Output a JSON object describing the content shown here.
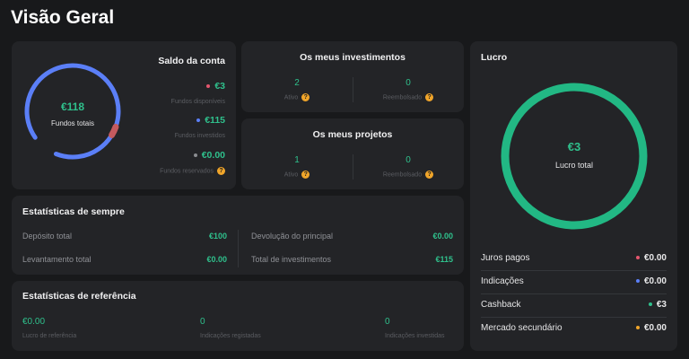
{
  "page": {
    "title": "Visão Geral"
  },
  "account": {
    "title": "Saldo da conta",
    "center_value": "€118",
    "center_label": "Fundos totais",
    "items": [
      {
        "value": "€3",
        "label": "Fundos disponíveis",
        "color": "#e4566e"
      },
      {
        "value": "€115",
        "label": "Fundos investidos",
        "color": "#5b7ff7"
      },
      {
        "value": "€0.00",
        "label": "Fundos reservados",
        "color": "#8a8c90"
      }
    ],
    "ring_colors": {
      "invested": "#5b7ff7",
      "available": "#c45a5e"
    }
  },
  "investments": {
    "title": "Os meus investimentos",
    "active_value": "2",
    "active_label": "Ativo",
    "repaid_value": "0",
    "repaid_label": "Reembolsado"
  },
  "projects": {
    "title": "Os meus projetos",
    "active_value": "1",
    "active_label": "Ativo",
    "repaid_value": "0",
    "repaid_label": "Reembolsado"
  },
  "alltime": {
    "title": "Estatísticas de sempre",
    "deposit_label": "Depósito total",
    "deposit_value": "€100",
    "withdraw_label": "Levantamento total",
    "withdraw_value": "€0.00",
    "principal_label": "Devolução do principal",
    "principal_value": "€0.00",
    "investments_label": "Total de investimentos",
    "investments_value": "€115"
  },
  "referral": {
    "title": "Estatísticas de referência",
    "profit_value": "€0.00",
    "profit_label": "Lucro de referência",
    "registered_value": "0",
    "registered_label": "Indicações registadas",
    "invested_value": "0",
    "invested_label": "Indicações investidas"
  },
  "profit": {
    "title": "Lucro",
    "center_value": "€3",
    "center_label": "Lucro total",
    "ring_color": "#22b884",
    "items": [
      {
        "label": "Juros pagos",
        "value": "€0.00",
        "color": "#e4566e"
      },
      {
        "label": "Indicações",
        "value": "€0.00",
        "color": "#5b7ff7"
      },
      {
        "label": "Cashback",
        "value": "€3",
        "color": "#2fc08c"
      },
      {
        "label": "Mercado secundário",
        "value": "€0.00",
        "color": "#f0a52a"
      }
    ]
  },
  "icons": {
    "info": "?"
  }
}
